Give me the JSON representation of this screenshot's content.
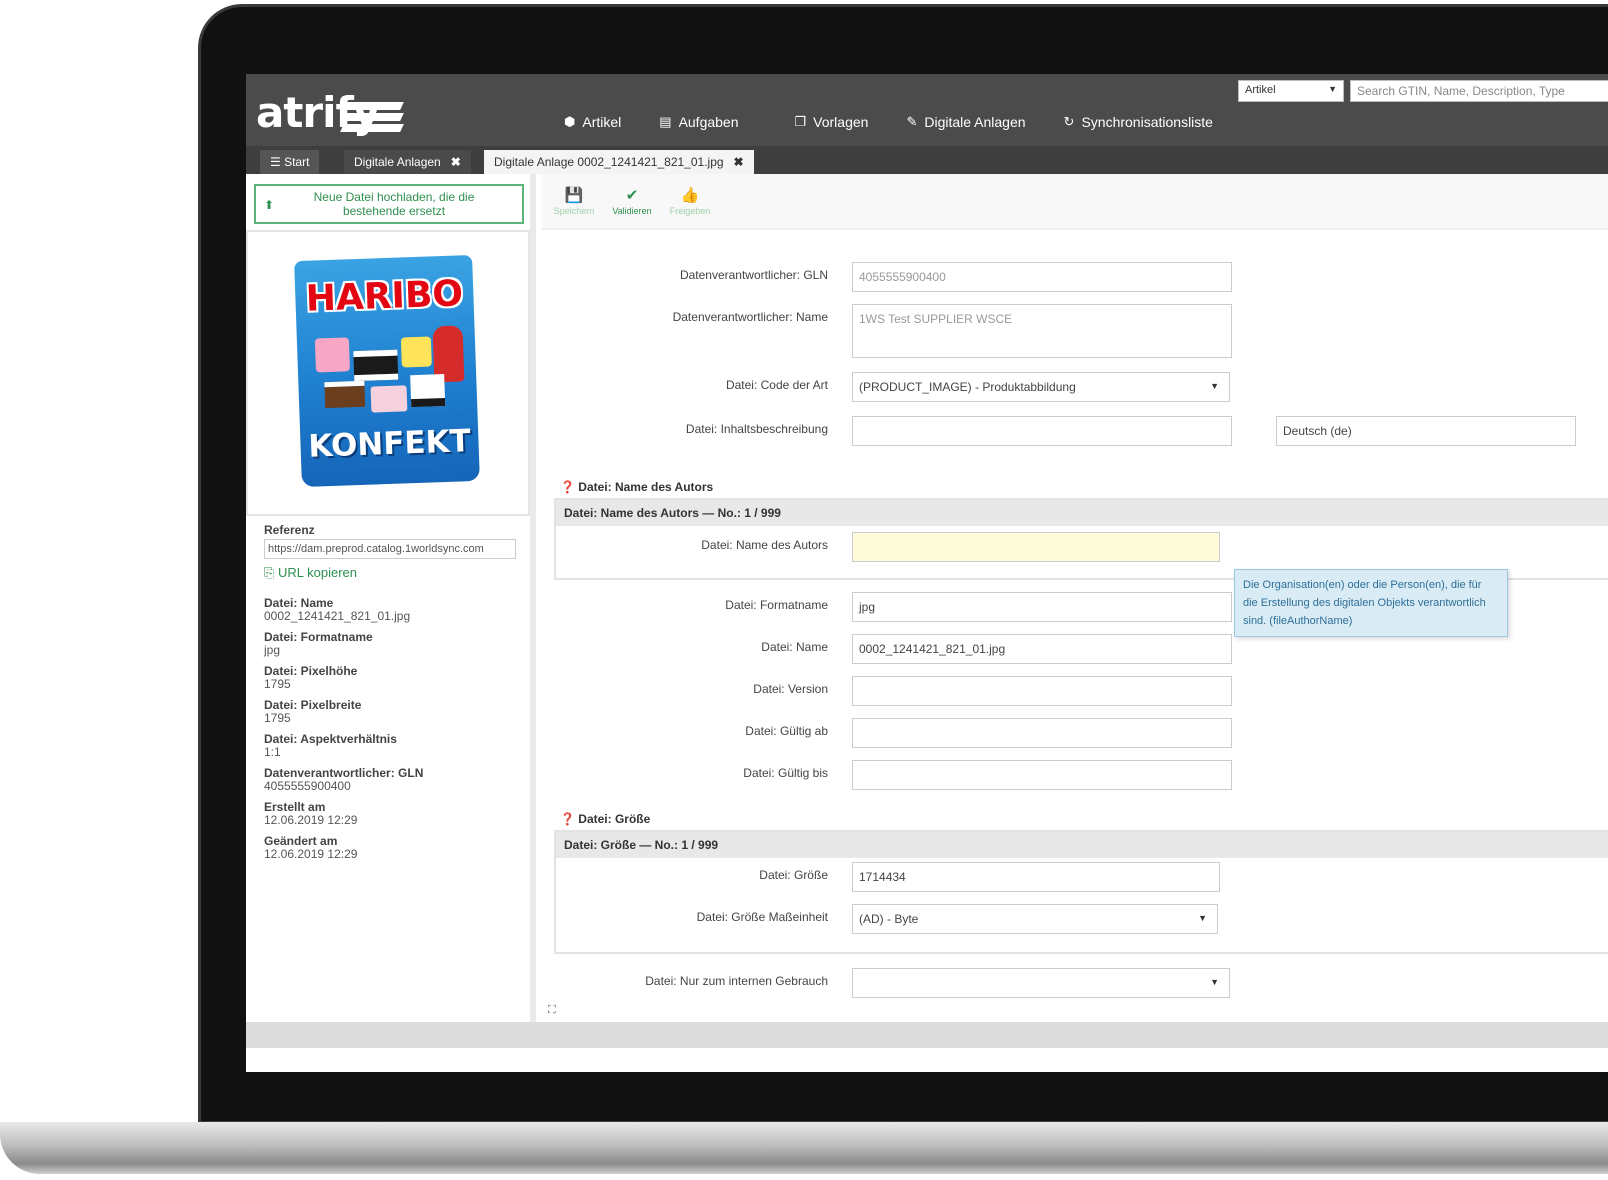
{
  "app": {
    "logo": "atrify",
    "search_type": "Artikel",
    "search_placeholder": "Search GTIN, Name, Description, Type"
  },
  "nav": [
    {
      "icon": "cube-icon",
      "label": "Artikel"
    },
    {
      "icon": "tasks-icon",
      "label": "Aufgaben"
    },
    {
      "icon": "templates-icon",
      "label": "Vorlagen"
    },
    {
      "icon": "paperclip-icon",
      "label": "Digitale Anlagen"
    },
    {
      "icon": "sync-icon",
      "label": "Synchronisationsliste"
    }
  ],
  "tabs": {
    "start": "Start",
    "digital": "Digitale Anlagen",
    "active": "Digitale Anlage 0002_1241421_821_01.jpg"
  },
  "left": {
    "upload_label": "Neue Datei hochladen, die die bestehende ersetzt",
    "image": {
      "brand": "HARIBO",
      "product": "KONFEKT"
    },
    "ref_label": "Referenz",
    "ref_value": "https://dam.preprod.catalog.1worldsync.com",
    "copy_label": "URL kopieren",
    "meta": [
      {
        "label": "Datei: Name",
        "value": "0002_1241421_821_01.jpg"
      },
      {
        "label": "Datei: Formatname",
        "value": "jpg"
      },
      {
        "label": "Datei: Pixelhöhe",
        "value": "1795"
      },
      {
        "label": "Datei: Pixelbreite",
        "value": "1795"
      },
      {
        "label": "Datei: Aspektverhältnis",
        "value": "1:1"
      },
      {
        "label": "Datenverantwortlicher: GLN",
        "value": "4055555900400"
      },
      {
        "label": "Erstellt am",
        "value": "12.06.2019 12:29"
      },
      {
        "label": "Geändert am",
        "value": "12.06.2019 12:29"
      }
    ]
  },
  "toolbar": {
    "save": "Speichern",
    "validate": "Validieren",
    "release": "Freigeben"
  },
  "form": {
    "gln": {
      "label": "Datenverantwortlicher: GLN",
      "value": "4055555900400"
    },
    "name": {
      "label": "Datenverantwortlicher: Name",
      "value": "1WS Test SUPPLIER WSCE"
    },
    "code": {
      "label": "Datei: Code der Art",
      "value": "(PRODUCT_IMAGE) - Produktabbildung"
    },
    "desc": {
      "label": "Datei: Inhaltsbeschreibung",
      "value": "",
      "lang": "Deutsch (de)"
    },
    "author_section": "Datei: Name des Autors",
    "author_group": "Datei: Name des Autors — No.: 1 / 999",
    "author": {
      "label": "Datei: Name des Autors",
      "value": ""
    },
    "tooltip": "Die Organisation(en) oder die Person(en), die für die Erstellung des digitalen Objekts verantwortlich sind. (fileAuthorName)",
    "format": {
      "label": "Datei: Formatname",
      "value": "jpg"
    },
    "fname": {
      "label": "Datei: Name",
      "value": "0002_1241421_821_01.jpg"
    },
    "version": {
      "label": "Datei: Version",
      "value": ""
    },
    "valid_from": {
      "label": "Datei: Gültig ab",
      "value": ""
    },
    "valid_to": {
      "label": "Datei: Gültig bis",
      "value": ""
    },
    "size_section": "Datei: Größe",
    "size_group": "Datei: Größe — No.: 1 / 999",
    "size": {
      "label": "Datei: Größe",
      "value": "1714434"
    },
    "size_unit": {
      "label": "Datei: Größe Maßeinheit",
      "value": "(AD) - Byte"
    },
    "internal": {
      "label": "Datei: Nur zum internen Gebrauch",
      "value": ""
    }
  }
}
